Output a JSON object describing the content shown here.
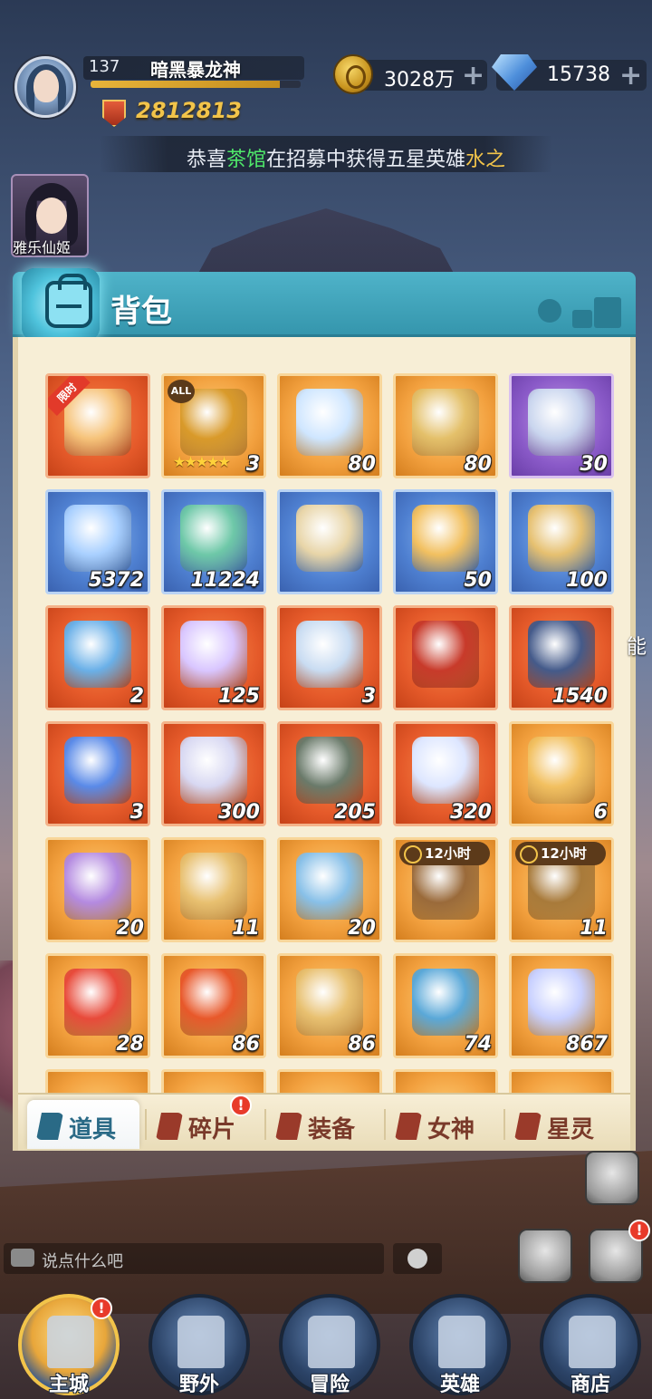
{
  "player": {
    "level": "137",
    "name": "暗黑暴龙神",
    "xp_fraction": 0.9,
    "power": "2812813"
  },
  "resources": {
    "gold": "3028万",
    "gems": "15738",
    "plus_label": "+"
  },
  "ticker": {
    "prefix": "恭喜",
    "guild": "茶馆",
    "middle": "在招募中获得五星英雄",
    "hero": "水之"
  },
  "featured_hero": {
    "name": "雅乐仙姬"
  },
  "panel": {
    "title": "背包"
  },
  "items": [
    {
      "qty": "",
      "bg": "orange",
      "art": "ring",
      "badge": "限时"
    },
    {
      "qty": "3",
      "bg": "gold",
      "art": "mask",
      "badge": "ALL",
      "stars": "★★★★★"
    },
    {
      "qty": "80",
      "bg": "gold",
      "art": "star-crystal"
    },
    {
      "qty": "80",
      "bg": "gold",
      "art": "gold-chest"
    },
    {
      "qty": "30",
      "bg": "purple",
      "art": "cube-chest"
    },
    {
      "qty": "5372",
      "bg": "blue",
      "art": "blue-crystal"
    },
    {
      "qty": "11224",
      "bg": "blue",
      "art": "herb"
    },
    {
      "qty": "",
      "bg": "blue",
      "art": "hourglass"
    },
    {
      "qty": "50",
      "bg": "blue",
      "art": "helmet"
    },
    {
      "qty": "100",
      "bg": "blue",
      "art": "scroll"
    },
    {
      "qty": "2",
      "bg": "orange",
      "art": "mystery-card"
    },
    {
      "qty": "125",
      "bg": "orange",
      "art": "orb"
    },
    {
      "qty": "3",
      "bg": "orange",
      "art": "silver-chest"
    },
    {
      "qty": "",
      "bg": "orange",
      "art": "red-helmet"
    },
    {
      "qty": "1540",
      "bg": "orange",
      "art": "dark-crystal"
    },
    {
      "qty": "3",
      "bg": "orange",
      "art": "rune-gem"
    },
    {
      "qty": "300",
      "bg": "orange",
      "art": "shuriken"
    },
    {
      "qty": "205",
      "bg": "orange",
      "art": "cannon-scroll"
    },
    {
      "qty": "320",
      "bg": "orange",
      "art": "diamond-rock"
    },
    {
      "qty": "6",
      "bg": "gold",
      "art": "puzzle-card"
    },
    {
      "qty": "20",
      "bg": "gold",
      "art": "puzzle-helmet"
    },
    {
      "qty": "11",
      "bg": "gold",
      "art": "purple-chest"
    },
    {
      "qty": "20",
      "bg": "gold",
      "art": "astrolabe"
    },
    {
      "qty": "",
      "bg": "gold",
      "art": "potion-barrel",
      "time": "12小时"
    },
    {
      "qty": "11",
      "bg": "gold",
      "art": "gold-barrel",
      "time": "12小时"
    },
    {
      "qty": "28",
      "bg": "gold",
      "art": "red-card"
    },
    {
      "qty": "86",
      "bg": "gold",
      "art": "fire-wheel"
    },
    {
      "qty": "86",
      "bg": "gold",
      "art": "sun-wheel"
    },
    {
      "qty": "74",
      "bg": "gold",
      "art": "ship-wheel"
    },
    {
      "qty": "867",
      "bg": "gold",
      "art": "shard"
    }
  ],
  "tabs": [
    {
      "label": "道具",
      "active": true
    },
    {
      "label": "碎片",
      "alert": "!"
    },
    {
      "label": "装备"
    },
    {
      "label": "女神"
    },
    {
      "label": "星灵"
    }
  ],
  "chat": {
    "placeholder": "说点什么吧"
  },
  "side": {
    "label": "能"
  },
  "nav": [
    {
      "label": "主城",
      "alert": "!"
    },
    {
      "label": "野外"
    },
    {
      "label": "冒险"
    },
    {
      "label": "英雄"
    },
    {
      "label": "商店"
    }
  ],
  "colors": {
    "header": "#3596ad",
    "panel_bg": "#f7eed6",
    "accent_gold": "#f2c44a",
    "tab_text": "#7a3a2a",
    "tab_active_text": "#2a6a86"
  }
}
